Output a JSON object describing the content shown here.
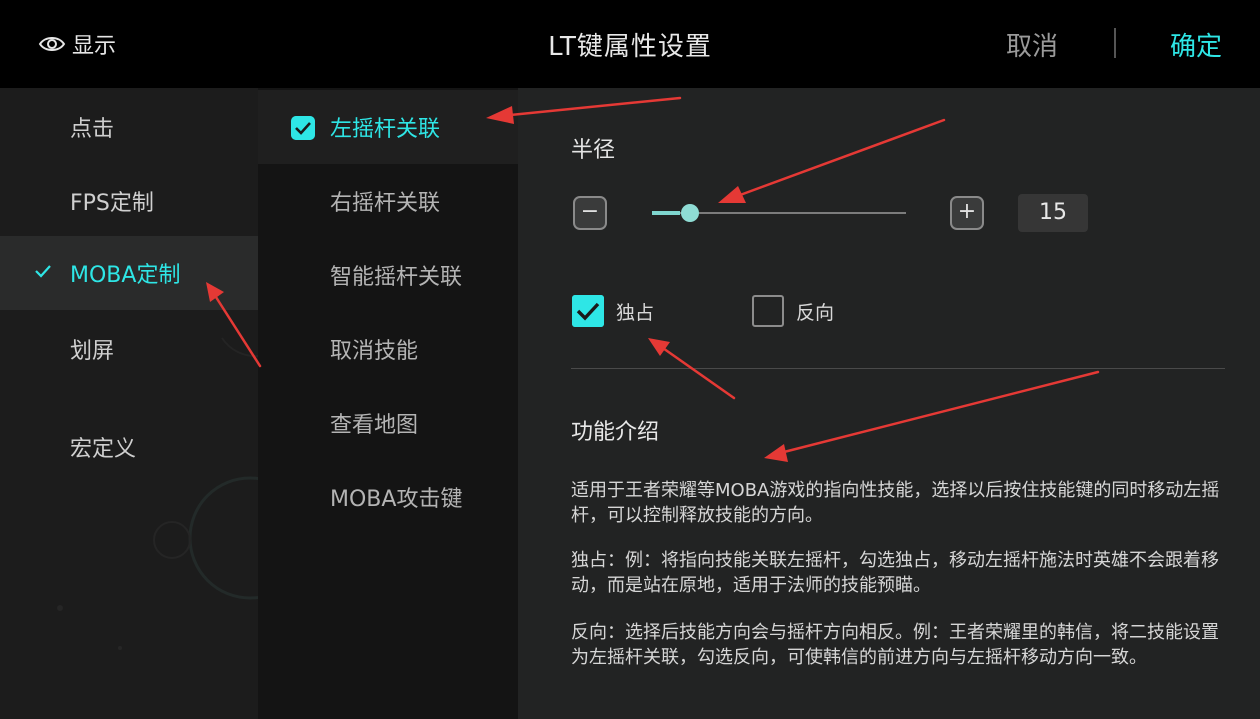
{
  "header": {
    "display_label": "显示",
    "display_icon": "eye-icon",
    "title": "LT键属性设置",
    "cancel_label": "取消",
    "confirm_label": "确定"
  },
  "sidebar": {
    "items": [
      {
        "label": "点击",
        "active": false
      },
      {
        "label": "FPS定制",
        "active": false
      },
      {
        "label": "MOBA定制",
        "active": true
      },
      {
        "label": "划屏",
        "active": false
      },
      {
        "label": "宏定义",
        "active": false
      }
    ]
  },
  "subnav": {
    "items": [
      {
        "label": "左摇杆关联",
        "active": true
      },
      {
        "label": "右摇杆关联",
        "active": false
      },
      {
        "label": "智能摇杆关联",
        "active": false
      },
      {
        "label": "取消技能",
        "active": false
      },
      {
        "label": "查看地图",
        "active": false
      },
      {
        "label": "MOBA攻击键",
        "active": false
      }
    ]
  },
  "settings": {
    "radius_label": "半径",
    "minus_label": "−",
    "plus_label": "+",
    "radius_value": "15",
    "slider_fraction": 0.11,
    "exclusive_label": "独占",
    "exclusive_checked": true,
    "reverse_label": "反向",
    "reverse_checked": false
  },
  "intro": {
    "title": "功能介绍",
    "paragraphs": [
      "适用于王者荣耀等MOBA游戏的指向性技能，选择以后按住技能键的同时移动左摇杆，可以控制释放技能的方向。",
      "独占：例：将指向技能关联左摇杆，勾选独占，移动左摇杆施法时英雄不会跟着移动，而是站在原地，适用于法师的技能预瞄。",
      "反向：选择后技能方向会与摇杆方向相反。例：王者荣耀里的韩信，将二技能设置为左摇杆关联，勾选反向，可使韩信的前进方向与左摇杆移动方向一致。"
    ]
  },
  "colors": {
    "accent": "#2ee6e6",
    "annotation_arrow": "#e53935"
  }
}
